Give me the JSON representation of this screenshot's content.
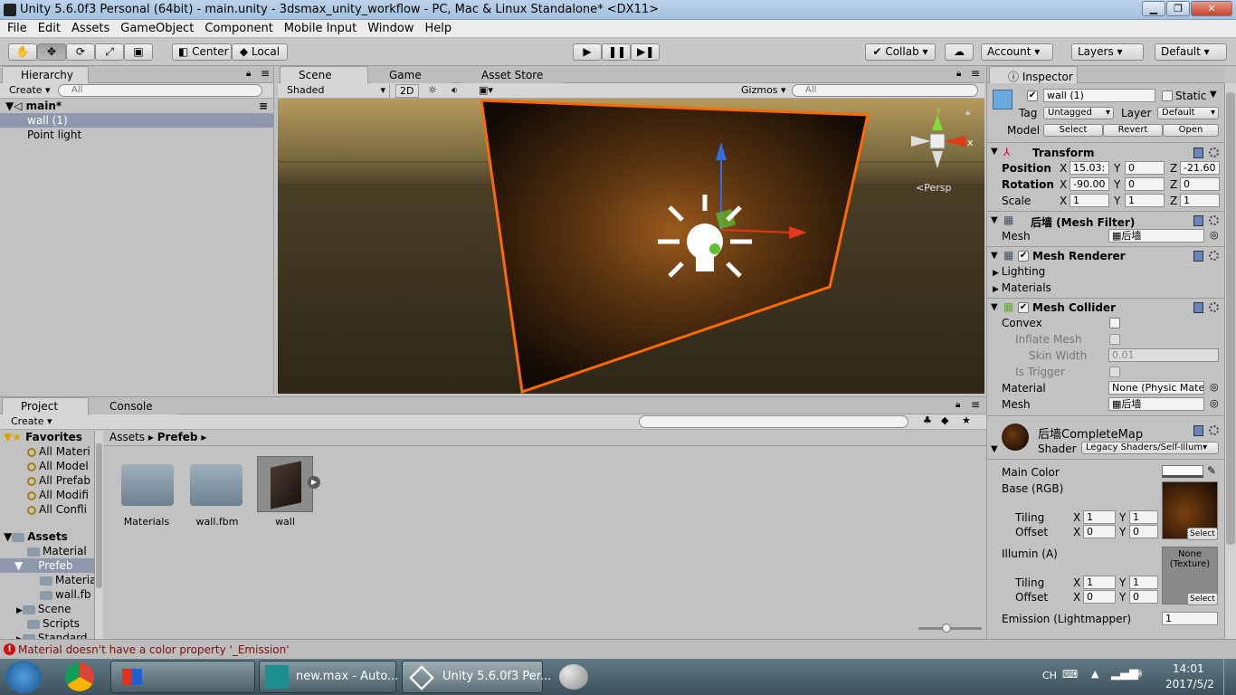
{
  "window": {
    "title": "Unity 5.6.0f3 Personal (64bit) - main.unity - 3dsmax_unity_workflow - PC, Mac & Linux Standalone* <DX11>"
  },
  "menu": [
    "File",
    "Edit",
    "Assets",
    "GameObject",
    "Component",
    "Mobile Input",
    "Window",
    "Help"
  ],
  "toolbar": {
    "pivot_center": "Center",
    "pivot_local": "Local",
    "collab": "Collab ▾",
    "account": "Account",
    "layers": "Layers",
    "layout": "Default"
  },
  "hierarchy": {
    "tab": "Hierarchy",
    "create": "Create ▾",
    "search_placeholder": "All",
    "scene": "main*",
    "items": [
      "wall (1)",
      "Point light"
    ]
  },
  "scene": {
    "tabs": [
      "Scene",
      "Game",
      "Asset Store"
    ],
    "shading": "Shaded",
    "mode_2d": "2D",
    "gizmos": "Gizmos ▾",
    "search_placeholder": "All",
    "persp": "Persp",
    "axis_x": "x",
    "axis_y": "y"
  },
  "project": {
    "tabs": [
      "Project",
      "Console"
    ],
    "create": "Create ▾",
    "favorites_label": "Favorites",
    "favorites": [
      "All Materi",
      "All Model",
      "All Prefab",
      "All Modifi",
      "All Confli"
    ],
    "assets_label": "Assets",
    "assets_tree": [
      "Material",
      "Prefeb",
      "Materia",
      "wall.fb",
      "Scene",
      "Scripts",
      "Standard"
    ],
    "breadcrumb": [
      "Assets",
      "Prefeb"
    ],
    "items": [
      "Materials",
      "wall.fbm",
      "wall"
    ]
  },
  "inspector": {
    "tab": "Inspector",
    "object_name": "wall (1)",
    "static": "Static",
    "tag_label": "Tag",
    "tag": "Untagged",
    "layer_label": "Layer",
    "layer": "Default",
    "model_label": "Model",
    "model_select": "Select",
    "model_revert": "Revert",
    "model_open": "Open",
    "transform": {
      "title": "Transform",
      "position": {
        "label": "Position",
        "x": "15.03:",
        "y": "0",
        "z": "-21.60"
      },
      "rotation": {
        "label": "Rotation",
        "x": "-90.00",
        "y": "0",
        "z": "0"
      },
      "scale": {
        "label": "Scale",
        "x": "1",
        "y": "1",
        "z": "1"
      }
    },
    "mesh_filter": {
      "title": "后墙 (Mesh Filter)",
      "mesh_label": "Mesh",
      "mesh": "后墙"
    },
    "mesh_renderer": {
      "title": "Mesh Renderer",
      "lighting": "Lighting",
      "materials": "Materials"
    },
    "mesh_collider": {
      "title": "Mesh Collider",
      "convex": "Convex",
      "inflate": "Inflate Mesh",
      "skin_label": "Skin Width",
      "skin": "0.01",
      "trigger": "Is Trigger",
      "material_label": "Material",
      "material": "None (Physic Mate",
      "mesh_label": "Mesh",
      "mesh": "后墙"
    },
    "material": {
      "name": "后墙CompleteMap",
      "shader_label": "Shader",
      "shader": "Legacy Shaders/Self-Illum",
      "main_color": "Main Color",
      "base": "Base (RGB)",
      "tiling": "Tiling",
      "offset": "Offset",
      "base_tiling": {
        "x": "1",
        "y": "1"
      },
      "base_offset": {
        "x": "0",
        "y": "0"
      },
      "illum": "Illumin (A)",
      "none_texture": "None (Texture)",
      "select": "Select",
      "illum_tiling": {
        "x": "1",
        "y": "1"
      },
      "illum_offset": {
        "x": "0",
        "y": "0"
      },
      "emission_label": "Emission (Lightmapper)",
      "emission": "1"
    }
  },
  "status": {
    "error": "Material doesn't have a color property '_Emission'"
  },
  "taskbar": {
    "max": "new.max - Auto...",
    "unity": "Unity 5.6.0f3 Per...",
    "lang": "CH",
    "time": "14:01",
    "date": "2017/5/2"
  },
  "colors": {
    "selection": "#8e97ab",
    "orange": "#ff6a00"
  }
}
